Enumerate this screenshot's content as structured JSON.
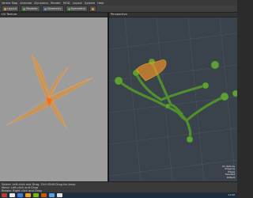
{
  "menubar": {
    "items": [
      "Vertex Map",
      "Animate",
      "Dynamics",
      "Render",
      "MOD",
      "Layout",
      "System",
      "Help"
    ]
  },
  "toolbar": {
    "items": [
      {
        "label": "Layout",
        "color": "#e0902a"
      },
      {
        "label": "Modeler",
        "color": "#5fa84f"
      },
      {
        "label": "Geometry",
        "color": "#6b8fd6"
      },
      {
        "label": "Symmetry",
        "color": "#5fa84f"
      },
      {
        "label": "",
        "color": "#e0902a"
      }
    ]
  },
  "viewports": {
    "left": {
      "header": "UV Texture"
    },
    "right": {
      "header": "Perspective"
    }
  },
  "info": {
    "lines": [
      "UV Vertices",
      "Polygons",
      "Edges",
      "Selected",
      "Default"
    ]
  },
  "status": {
    "line1": "Select: Left-click and Drag, Ctrl+Shift Drag for lasso",
    "line2": "Move: Left-click and Drag",
    "line3": "Rotate: Right-click and Drag"
  },
  "taskbar": {
    "apps": [
      "#c0392b",
      "#e8e8e8",
      "#3b7dd8",
      "#f0a020",
      "#7fb800",
      "#d35400",
      "#5a9fd6",
      "#e0e0e0"
    ],
    "clock": "11:42"
  },
  "colors": {
    "uv_mesh": "#e8902a",
    "plant": "#5da035",
    "selection": "#f0a020"
  }
}
